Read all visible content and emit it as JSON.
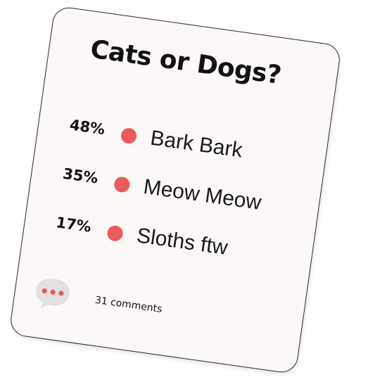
{
  "poll": {
    "title": "Cats or Dogs?",
    "options": [
      {
        "percent": "48%",
        "label": "Bark Bark"
      },
      {
        "percent": "35%",
        "label": "Meow Meow"
      },
      {
        "percent": "17%",
        "label": "Sloths ftw"
      }
    ],
    "comments": {
      "count_label": "31 comments",
      "icon": "chat-bubble-icon"
    }
  },
  "colors": {
    "card_background": "#fbf8f7",
    "dot": "#ea5a5a",
    "bubble": "#e3e1e0",
    "text": "#111111"
  }
}
